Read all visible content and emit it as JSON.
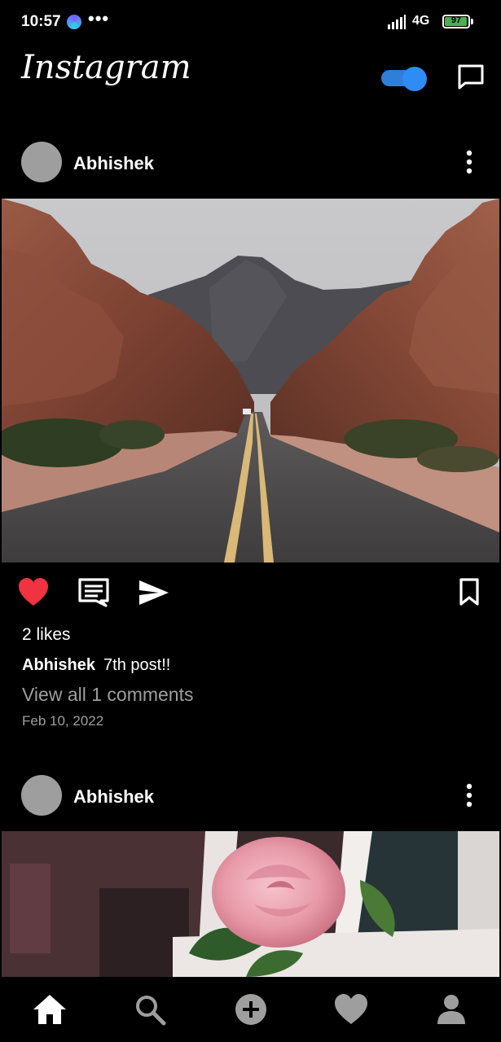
{
  "status_bar": {
    "time": "10:57",
    "more_indicator": "•••",
    "network": "4G",
    "battery_level": "97",
    "battery_fraction": 0.97
  },
  "header": {
    "app_title": "Instagram",
    "toggle_on": true,
    "accent_color": "#2f8cf5",
    "icons": [
      "toggle-switch",
      "direct-message-icon"
    ]
  },
  "feed": {
    "posts": [
      {
        "username": "Abhishek",
        "image_subject": "desert-road-photo",
        "liked": true,
        "like_color": "#ef3340",
        "likes_text": "2 likes",
        "caption_user": "Abhishek",
        "caption_text": "7th post!!",
        "comments_link": "View all 1 comments",
        "date": "Feb 10, 2022"
      },
      {
        "username": "Abhishek",
        "image_subject": "pink-rose-photo"
      }
    ]
  },
  "bottom_nav": {
    "items": [
      "home-icon",
      "search-icon",
      "add-post-icon",
      "activity-heart-icon",
      "profile-icon"
    ],
    "active": "home-icon"
  }
}
